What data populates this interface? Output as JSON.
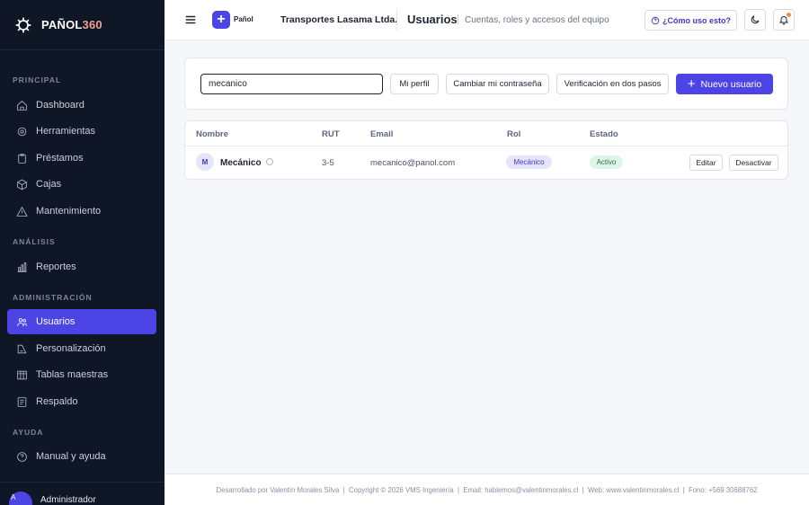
{
  "brand": {
    "name_main": "PAÑOL",
    "name_accent": "360"
  },
  "sidebar": {
    "sections": [
      {
        "title": "PRINCIPAL"
      },
      {
        "title": "ANÁLISIS"
      },
      {
        "title": "ADMINISTRACIÓN"
      },
      {
        "title": "AYUDA"
      }
    ],
    "items": [
      {
        "label": "Dashboard",
        "icon": "home-icon"
      },
      {
        "label": "Herramientas",
        "icon": "gear-icon"
      },
      {
        "label": "Préstamos",
        "icon": "clipboard-icon"
      },
      {
        "label": "Cajas",
        "icon": "box-icon"
      },
      {
        "label": "Mantenimiento",
        "icon": "warning-icon"
      },
      {
        "label": "Reportes",
        "icon": "bar-chart-icon"
      },
      {
        "label": "Usuarios",
        "icon": "users-icon",
        "active": true
      },
      {
        "label": "Personalización",
        "icon": "palette-icon"
      },
      {
        "label": "Tablas maestras",
        "icon": "table-icon"
      },
      {
        "label": "Respaldo",
        "icon": "archive-icon"
      },
      {
        "label": "Manual y ayuda",
        "icon": "help-icon"
      }
    ],
    "user": {
      "initial": "A",
      "name": "Administrador"
    }
  },
  "header": {
    "logo_label": "Pañol",
    "company": "Transportes Lasama Ltda.",
    "title": "Usuarios",
    "separator": "|",
    "subtitle": "Cuentas, roles y accesos del equipo",
    "help_label": "¿Cómo uso esto?"
  },
  "toolbar": {
    "search_value": "mecanico",
    "my_profile": "Mi perfil",
    "change_password": "Cambiar mi contraseña",
    "two_step": "Verificación en dos pasos",
    "new_user": "Nuevo usuario"
  },
  "table": {
    "columns": [
      "Nombre",
      "RUT",
      "Email",
      "Rol",
      "Estado"
    ],
    "rows": [
      {
        "initial": "M",
        "name": "Mecánico",
        "rut": "3-5",
        "email": "mecanico@panol.com",
        "role": "Mecánico",
        "state": "Activo",
        "edit": "Editar",
        "deactivate": "Desactivar"
      }
    ]
  },
  "footer": {
    "text": "Desarrollado por Valentín Morales Silva  |  Copyright © 2026 VMS Ingeniería  |  Email: hablemos@valentinmorales.cl  |  Web: www.valentinmorales.cl  |  Fono: +569 30688762"
  },
  "colors": {
    "accent": "#4d44e5",
    "sidebar_bg": "#0f1626",
    "active_badge": "#dff5e7"
  }
}
